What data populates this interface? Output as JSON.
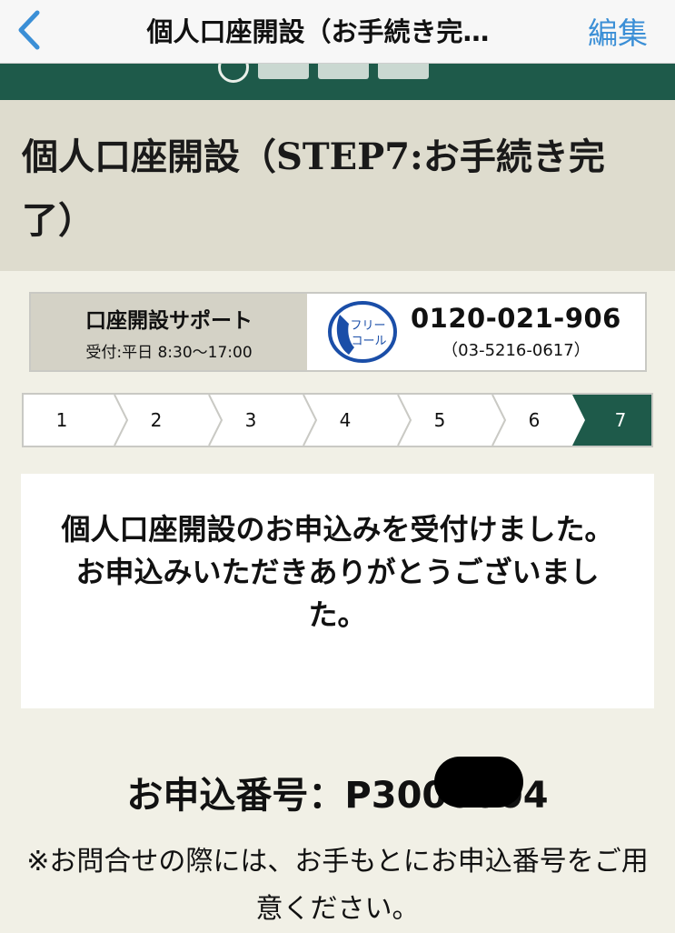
{
  "nav": {
    "title": "個人口座開設（お手続き完…",
    "edit_label": "編集"
  },
  "heading": {
    "title": "個人口座開設（STEP7:お手続き完了）"
  },
  "support": {
    "label": "口座開設サポート",
    "hours": "受付:平日 8:30〜17:00",
    "phone": "0120-021-906",
    "phone_alt": "（03-5216-0617）",
    "freecall_line1": "フリー",
    "freecall_line2": "コール"
  },
  "steps": {
    "items": [
      "1",
      "2",
      "3",
      "4",
      "5",
      "6",
      "7"
    ],
    "current": 7
  },
  "message": {
    "text": "個人口座開設のお申込みを受付けました。お申込みいただきありがとうございました。"
  },
  "application": {
    "number_text": "お申込番号：P3000004"
  },
  "note": {
    "text": "※お問合せの際には、お手もとにお申込番号をご用意ください。"
  },
  "colors": {
    "accent_green": "#1e5a4a",
    "ios_blue": "#3b8fd6",
    "freecall_blue": "#1a4ea8"
  }
}
